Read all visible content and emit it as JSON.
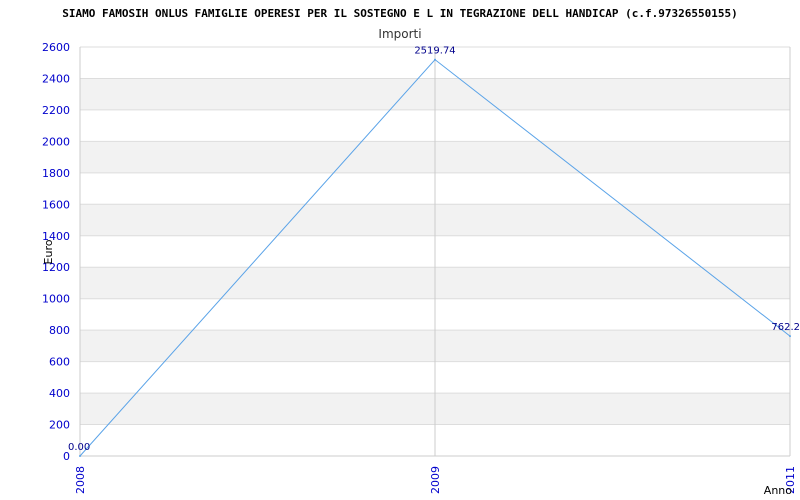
{
  "chart_data": {
    "type": "line",
    "title": "SIAMO FAMOSIH ONLUS FAMIGLIE OPERESI PER IL SOSTEGNO E L IN TEGRAZIONE DELL HANDICAP (c.f.97326550155)",
    "subtitle": "Importi",
    "xlabel": "Anno",
    "ylabel": "Euro",
    "x": [
      "2008",
      "2009",
      "2011"
    ],
    "series": [
      {
        "values": [
          0,
          2519.74,
          762.2
        ],
        "labels": [
          "0.00",
          "2519.74",
          "762.2"
        ]
      }
    ],
    "ylim": [
      0,
      2600
    ],
    "yticks": [
      0,
      200,
      400,
      600,
      800,
      1000,
      1200,
      1400,
      1600,
      1800,
      2000,
      2200,
      2400,
      2600
    ],
    "grid": true,
    "colors": {
      "line": "#5aa3e8",
      "axis_text": "#0000cc",
      "band": "#f2f2f2",
      "label": "#00008b"
    }
  }
}
